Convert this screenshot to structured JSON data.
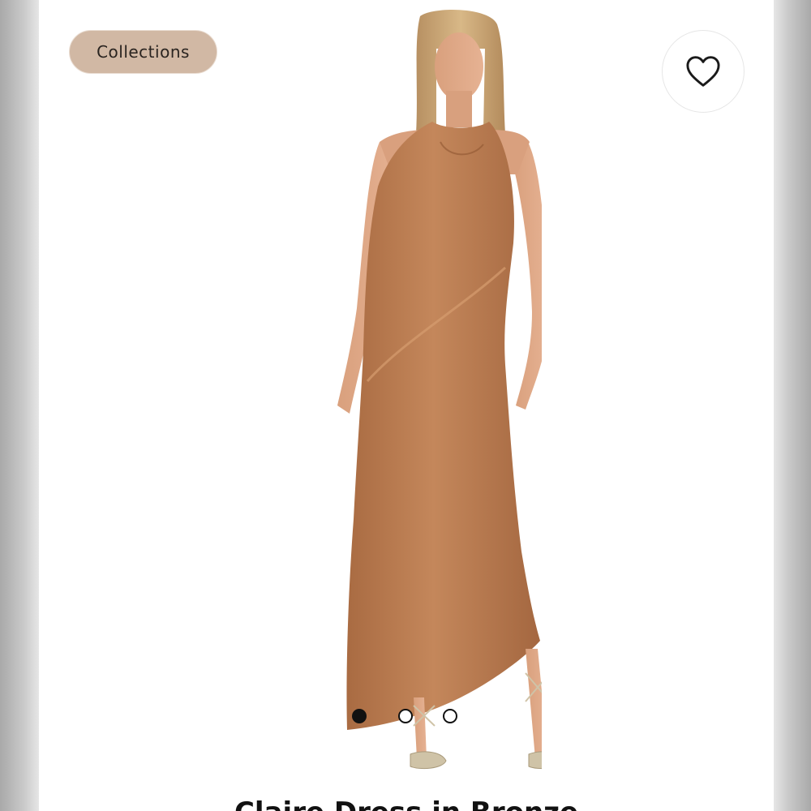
{
  "collections_button": {
    "label": "Collections"
  },
  "favorite_button": {
    "icon": "heart-outline-icon"
  },
  "product": {
    "image_alt": "Model wearing a copper satin halter-neck maxi dress",
    "dress_color": "#b97a4f",
    "title": "Claire Dress in Bronze"
  },
  "carousel": {
    "total": 3,
    "active_index": 0
  },
  "colors": {
    "pill": "#d1b8a4",
    "dot": "#111111"
  }
}
